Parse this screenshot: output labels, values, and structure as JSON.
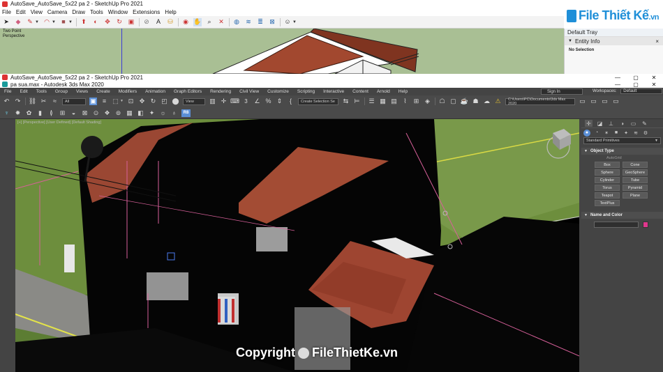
{
  "sketchup": {
    "title": "AutoSave_AutoSave_5x22 pa 2 - SketchUp Pro 2021",
    "menu": [
      "File",
      "Edit",
      "View",
      "Camera",
      "Draw",
      "Tools",
      "Window",
      "Extensions",
      "Help"
    ],
    "viewport": {
      "camera_label": "Two Point",
      "projection_label": "Perspective"
    },
    "tray": {
      "title": "Default Tray",
      "panel_title": "Entity Info",
      "close_glyph": "×",
      "collapse_glyph": "▼",
      "status": "No Selection"
    },
    "toolbar_icons": [
      "select-arrow",
      "eraser",
      "pencil",
      "arc",
      "rectangle",
      "push-pull",
      "follow-me",
      "move",
      "rotate",
      "scale",
      "offset",
      "tape-measure",
      "protractor",
      "text",
      "axes",
      "orbit",
      "pan",
      "zoom",
      "zoom-extents",
      "warehouse",
      "extension-warehouse",
      "layout",
      "user-account"
    ]
  },
  "watermark_top": {
    "brand": "File Thiết Kế",
    "tld": ".vn"
  },
  "max": {
    "title_autosave": "AutoSave_AutoSave_5x22 pa 2 - SketchUp Pro 2021",
    "title": "pa sua.max - Autodesk 3ds Max 2020",
    "window_controls": [
      "—",
      "▢",
      "✕"
    ],
    "menu": [
      "File",
      "Edit",
      "Tools",
      "Group",
      "Views",
      "Create",
      "Modifiers",
      "Animation",
      "Graph Editors",
      "Rendering",
      "Civil View",
      "Customize",
      "Scripting",
      "Interactive",
      "Content",
      "Arnold",
      "Help"
    ],
    "sign_in": "Sign In",
    "workspaces_label": "Workspaces:",
    "workspaces_value": "Default",
    "selection_filter": "All",
    "reference_coord": "View",
    "selection_set": "Create Selection Se",
    "project_path": "C:\\Users\\PC\\Documents\\3ds Max 2020",
    "viewport_label": "[+] [Perspective] [User Defined] [Default Shading]",
    "render_badge": "R8",
    "command_panel": {
      "category": "Standard Primitives",
      "rollout_object_type": "Object Type",
      "autogrid": "AutoGrid",
      "object_buttons": [
        "Box",
        "Cone",
        "Sphere",
        "GeoSphere",
        "Cylinder",
        "Tube",
        "Torus",
        "Pyramid",
        "Teapot",
        "Plane",
        "TextPlus"
      ],
      "rollout_name_color": "Name and Color",
      "object_color": "#e0378d"
    }
  },
  "copyright": {
    "text": "Copyright",
    "brand": "FileThietKe.vn"
  }
}
